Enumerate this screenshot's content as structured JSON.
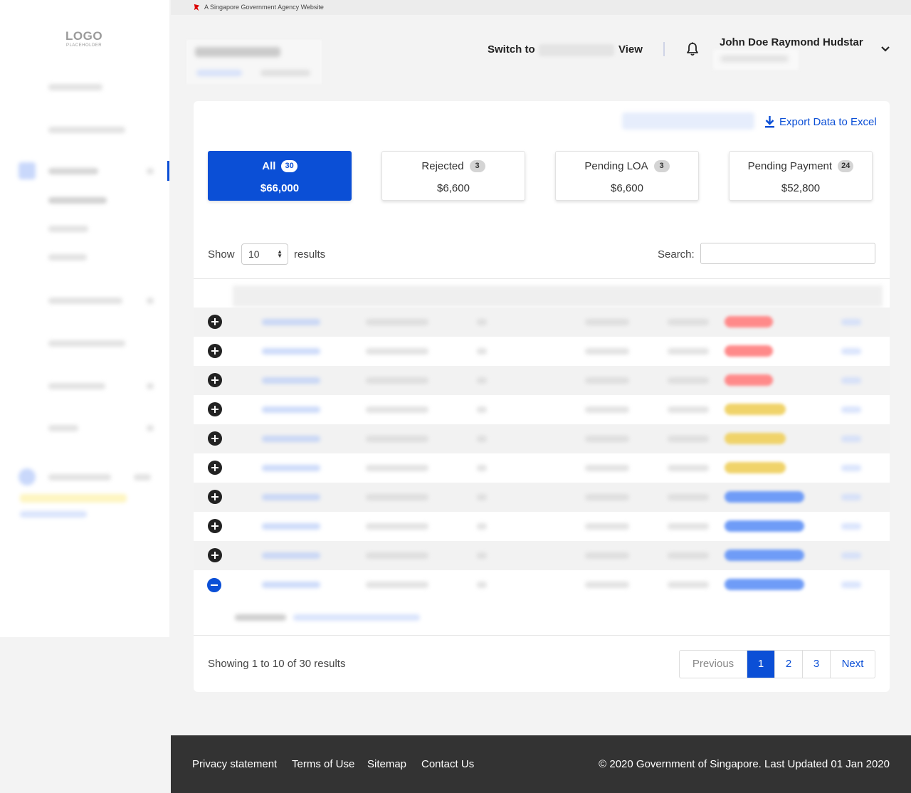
{
  "logo": {
    "main": "LOGO",
    "sub": "PLACEHOLDER"
  },
  "gov_banner": "A Singapore Government Agency Website",
  "header": {
    "switch_prefix": "Switch to",
    "switch_suffix": "View",
    "user_name": "John Doe Raymond Hudstar"
  },
  "export_label": "Export Data to Excel",
  "filters": [
    {
      "label": "All",
      "count": "30",
      "amount": "$66,000",
      "active": true
    },
    {
      "label": "Rejected",
      "count": "3",
      "amount": "$6,600",
      "active": false
    },
    {
      "label": "Pending LOA",
      "count": "3",
      "amount": "$6,600",
      "active": false
    },
    {
      "label": "Pending Payment",
      "count": "24",
      "amount": "$52,800",
      "active": false
    }
  ],
  "table_controls": {
    "show_label": "Show",
    "page_size": "10",
    "results_label": "results",
    "search_label": "Search:"
  },
  "status_colors": [
    "#ff8a8a",
    "#ff8a8a",
    "#ff8a8a",
    "#f0d36a",
    "#f0d36a",
    "#f0d36a",
    "#6f9cf7",
    "#6f9cf7",
    "#6f9cf7",
    "#6f9cf7"
  ],
  "showing_text": "Showing 1 to 10 of 30 results",
  "pagination": {
    "previous": "Previous",
    "pages": [
      "1",
      "2",
      "3"
    ],
    "current": "1",
    "next": "Next"
  },
  "footer": {
    "links": [
      "Privacy statement",
      "Terms of Use",
      "Sitemap",
      "Contact Us"
    ],
    "copyright": "© 2020 Government of Singapore. Last Updated 01 Jan 2020"
  },
  "colors": {
    "primary": "#0b4fd6",
    "footer_bg": "#333333"
  }
}
